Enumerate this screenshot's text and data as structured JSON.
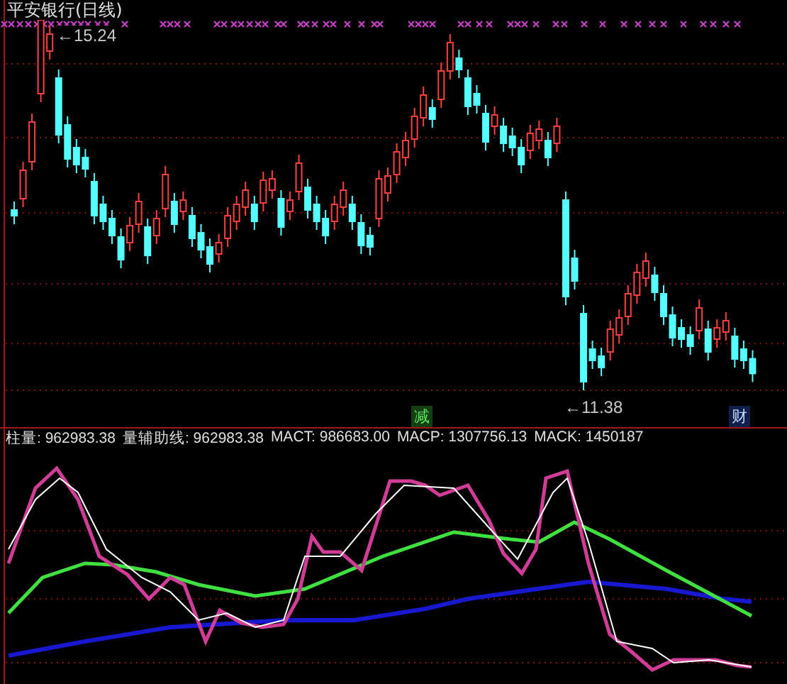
{
  "chart": {
    "title": "平安银行(日线)",
    "high_label": "←15.24",
    "low_label": "←11.38",
    "signals": [
      {
        "text": "减",
        "kind": "reduce"
      },
      {
        "text": "财",
        "kind": "finance"
      }
    ]
  },
  "indicator": {
    "readings": [
      {
        "name": "柱量:",
        "value": "962983.38"
      },
      {
        "name": "量辅助线:",
        "value": "962983.38"
      },
      {
        "name": "MACT:",
        "value": "986683.00"
      },
      {
        "name": "MACP:",
        "value": "1307756.13"
      },
      {
        "name": "MACK:",
        "value": "1450187"
      }
    ]
  }
}
